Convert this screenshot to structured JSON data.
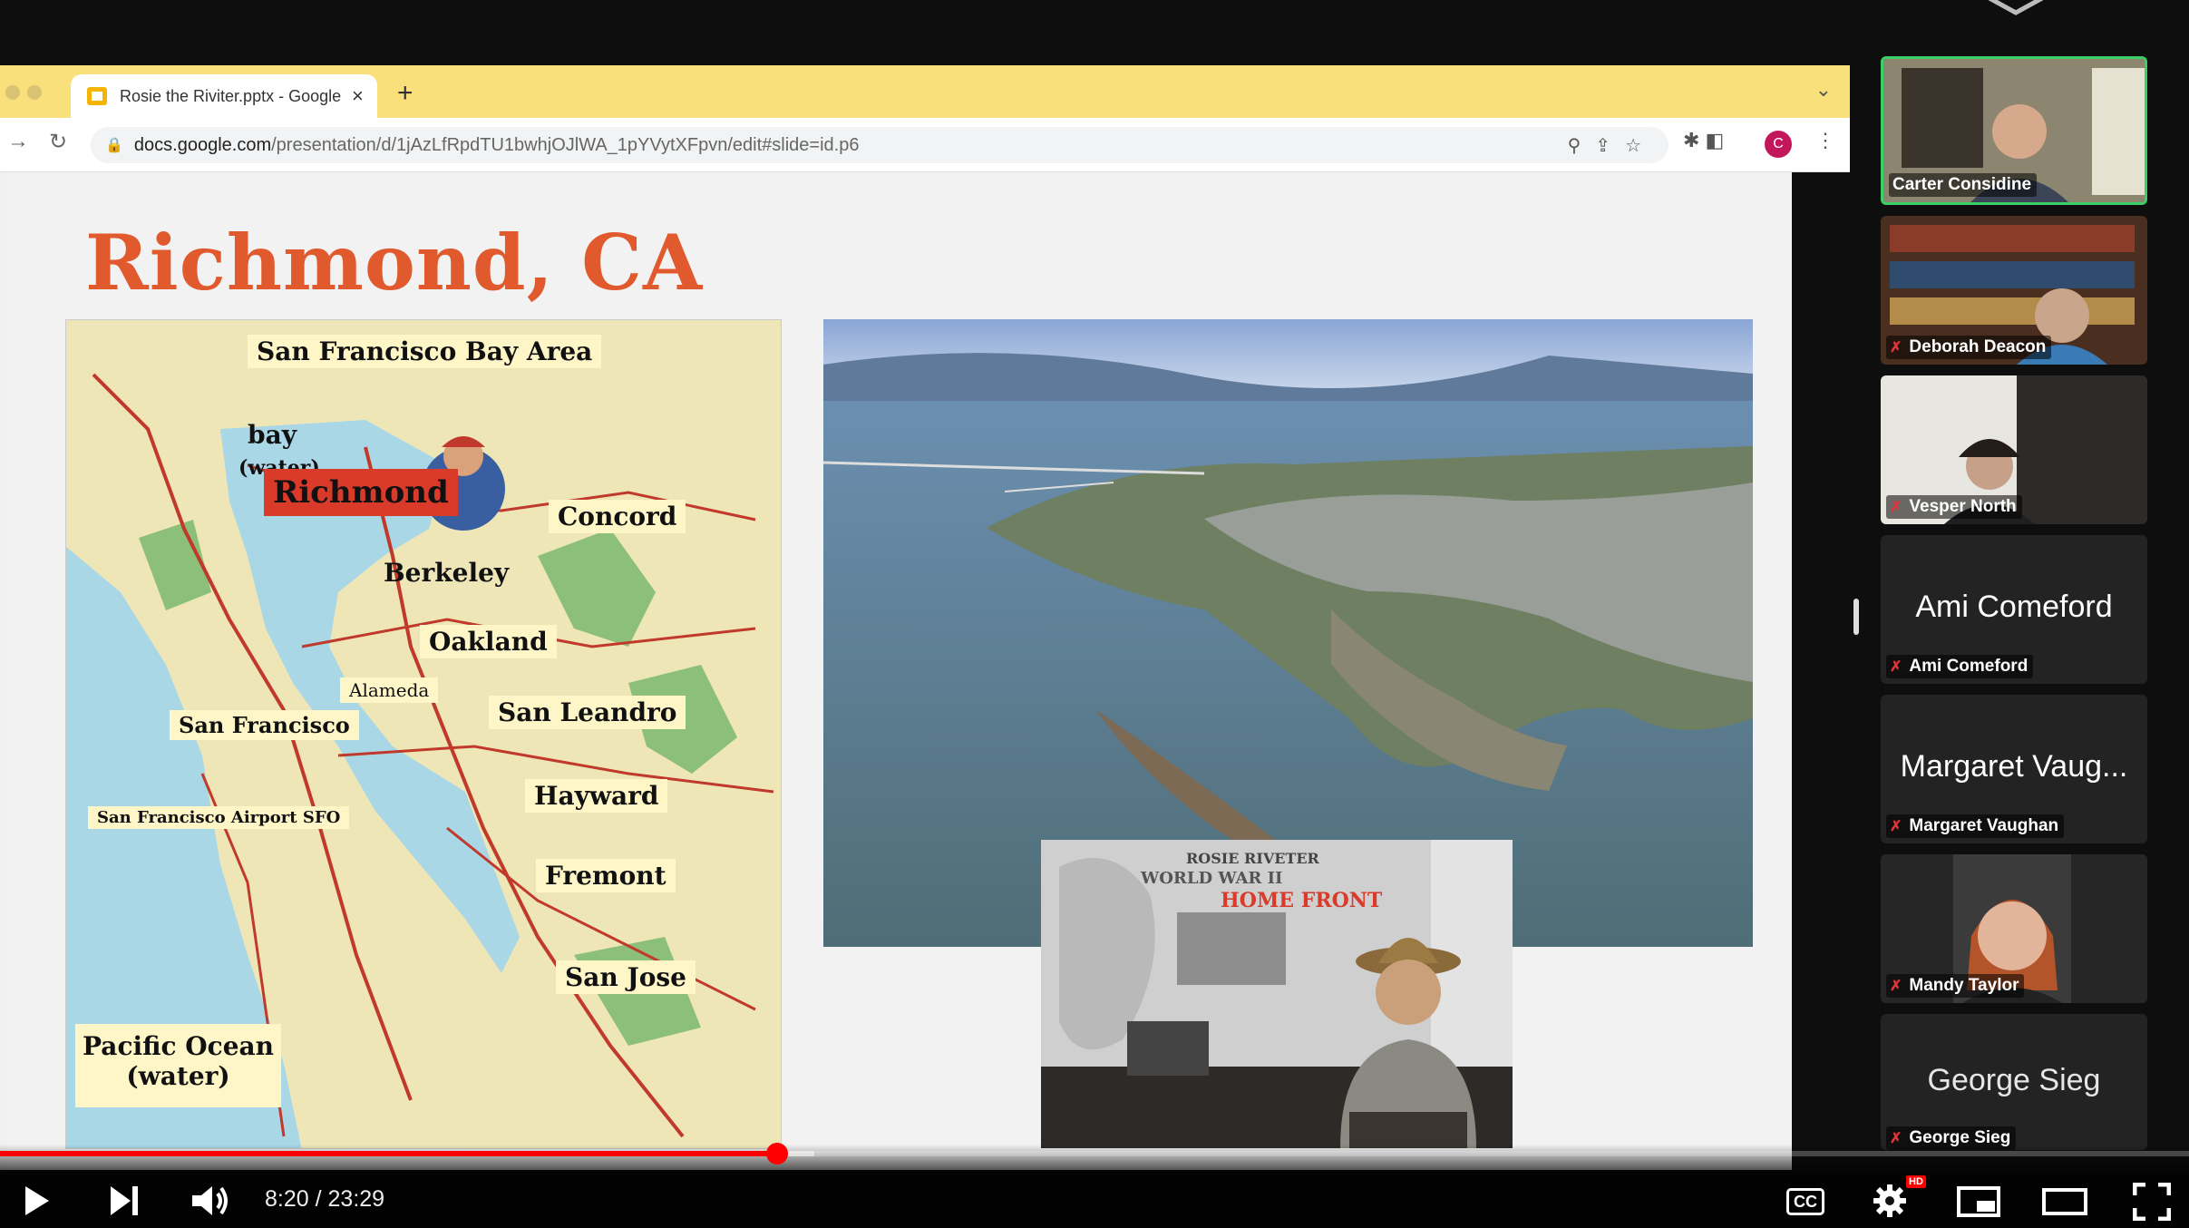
{
  "browser": {
    "tab_title": "Rosie the Riviter.pptx - Google",
    "tab_close": "×",
    "new_tab": "+",
    "url_host": "docs.google.com",
    "url_path": "/presentation/d/1jAzLfRpdTU1bwhjOJlWA_1pYVytXFpvn/edit#slide=id.p6",
    "avatar_letter": "C"
  },
  "slide": {
    "title": "Richmond, CA",
    "map_labels": {
      "bay_area": "San Francisco Bay Area",
      "bay": "bay",
      "water": "(water)",
      "richmond": "Richmond",
      "concord": "Concord",
      "berkeley": "Berkeley",
      "oakland": "Oakland",
      "alameda": "Alameda",
      "san_francisco": "San Francisco",
      "san_leandro": "San Leandro",
      "hayward": "Hayward",
      "sf_airport": "San Francisco Airport   SFO",
      "fremont": "Fremont",
      "san_jose": "San Jose",
      "pacific_ocean": "Pacific Ocean",
      "pacific_water": "(water)"
    },
    "sign_line1": "ROSIE RIVETER",
    "sign_line2": "WORLD WAR II",
    "sign_line3": "HOME FRONT"
  },
  "participants": [
    {
      "name": "Carter Considine",
      "active": true
    },
    {
      "name": "Deborah Deacon"
    },
    {
      "name": "Vesper North"
    },
    {
      "name": "Ami Comeford",
      "display": "Ami Comeford"
    },
    {
      "name": "Margaret Vaughan",
      "display": "Margaret Vaug..."
    },
    {
      "name": "Mandy Taylor"
    },
    {
      "name": "George Sieg",
      "display": "George Sieg"
    }
  ],
  "player": {
    "current_time": "8:20",
    "separator": " / ",
    "duration": "23:29",
    "progress_fraction": 0.355,
    "cc_label": "CC",
    "hd_badge": "HD"
  },
  "colors": {
    "tab_bar": "#f9e07a",
    "title_orange": "#e05a2e",
    "active_speaker": "#38d067",
    "progress_red": "#ff0000"
  }
}
